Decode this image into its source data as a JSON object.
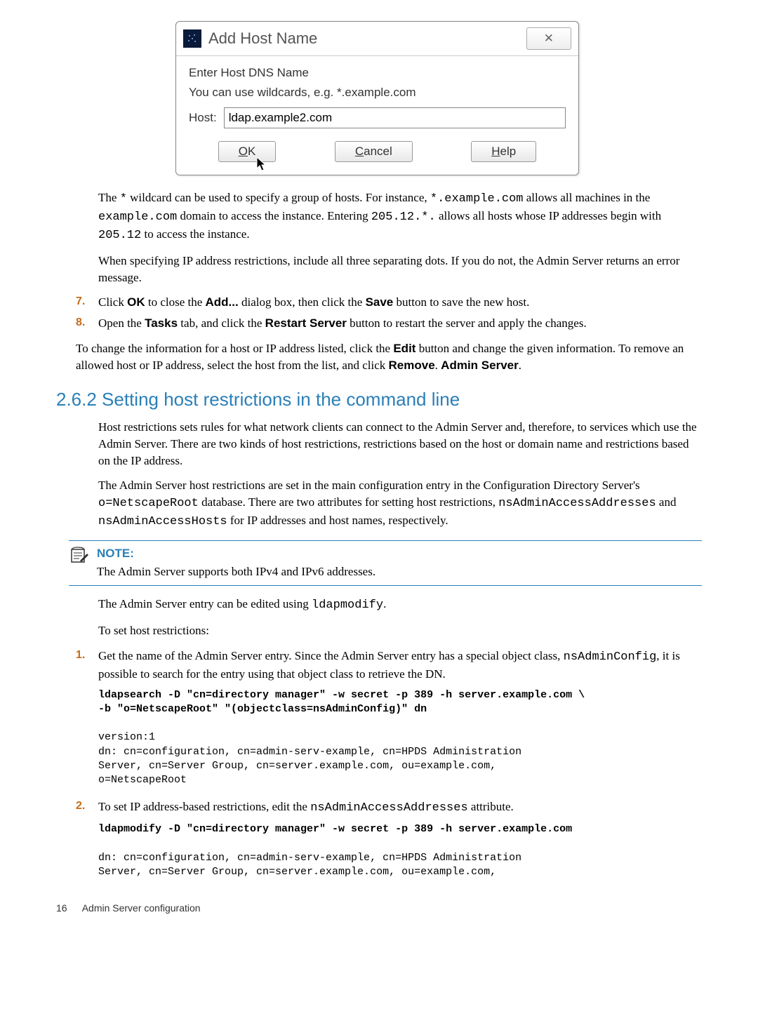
{
  "dialog": {
    "title": "Add Host Name",
    "instr1": "Enter Host DNS Name",
    "instr2": "You can use wildcards, e.g. *.example.com",
    "host_label": "Host:",
    "host_value": "ldap.example2.com",
    "ok_pre": "O",
    "ok_post": "K",
    "cancel_pre": "C",
    "cancel_post": "ancel",
    "help_pre": "H",
    "help_post": "elp",
    "close_glyph": "✕"
  },
  "para_wildcard_1": "The ",
  "para_wildcard_code1": "*",
  "para_wildcard_2": " wildcard can be used to specify a group of hosts. For instance, ",
  "para_wildcard_code2": "*.example.com",
  "para_wildcard_3": " allows all machines in the ",
  "para_wildcard_code3": "example.com",
  "para_wildcard_4": " domain to access the instance. Entering ",
  "para_wildcard_code4": "205.12.*.",
  "para_wildcard_5": " allows all hosts whose IP addresses begin with ",
  "para_wildcard_code5": "205.12",
  "para_wildcard_6": " to access the instance.",
  "para_ip": "When specifying IP address restrictions, include all three separating dots. If you do not, the Admin Server returns an error message.",
  "step7_num": "7.",
  "step7_a": "Click ",
  "step7_b": "OK",
  "step7_c": " to close the ",
  "step7_d": "Add...",
  "step7_e": " dialog box, then click the ",
  "step7_f": "Save",
  "step7_g": " button to save the new host.",
  "step8_num": "8.",
  "step8_a": "Open the ",
  "step8_b": "Tasks",
  "step8_c": " tab, and click the ",
  "step8_d": "Restart Server",
  "step8_e": " button to restart the server and apply the changes.",
  "para_edit_a": "To change the information for a host or IP address listed, click the ",
  "para_edit_b": "Edit",
  "para_edit_c": " button and change the given information. To remove an allowed host or IP address, select the host from the list, and click ",
  "para_edit_d": "Remove",
  "para_edit_e": ". ",
  "para_edit_f": "Admin Server",
  "para_edit_g": ".",
  "section_heading": "2.6.2 Setting host restrictions in the command line",
  "para_hostrest": "Host restrictions sets rules for what network clients can connect to the Admin Server and, therefore, to services which use the Admin Server. There are two kinds of host restrictions, restrictions based on the host or domain name and restrictions based on the IP address.",
  "para_conf_a": "The Admin Server host restrictions are set in the main configuration entry in the Configuration Directory Server's ",
  "para_conf_code1": "o=NetscapeRoot",
  "para_conf_b": " database. There are two attributes for setting host restrictions, ",
  "para_conf_code2": "nsAdminAccessAddresses",
  "para_conf_c": " and ",
  "para_conf_code3": "nsAdminAccessHosts",
  "para_conf_d": " for IP addresses and host names, respectively.",
  "note_label": "NOTE:",
  "note_text": "The Admin Server supports both IPv4 and IPv6 addresses.",
  "para_ldapmod_a": "The Admin Server entry can be edited using ",
  "para_ldapmod_code": "ldapmodify",
  "para_ldapmod_b": ".",
  "para_toset": "To set host restrictions:",
  "n1_num": "1.",
  "n1_a": "Get the name of the Admin Server entry. Since the Admin Server entry has a special object class, ",
  "n1_code": "nsAdminConfig",
  "n1_b": ", it is possible to search for the entry using that object class to retrieve the DN.",
  "code1_bold": "ldapsearch -D \"cn=directory manager\" -w secret -p 389 -h server.example.com \\\n-b \"o=NetscapeRoot\" \"(objectclass=nsAdminConfig)\" dn",
  "code1_plain": "version:1\ndn: cn=configuration, cn=admin-serv-example, cn=HPDS Administration\nServer, cn=Server Group, cn=server.example.com, ou=example.com,\no=NetscapeRoot",
  "n2_num": "2.",
  "n2_a": "To set IP address-based restrictions, edit the ",
  "n2_code": "nsAdminAccessAddresses",
  "n2_b": " attribute.",
  "code2_bold": "ldapmodify -D \"cn=directory manager\" -w secret -p 389 -h server.example.com",
  "code2_plain": "dn: cn=configuration, cn=admin-serv-example, cn=HPDS Administration\nServer, cn=Server Group, cn=server.example.com, ou=example.com,",
  "footer_page": "16",
  "footer_text": "Admin Server configuration"
}
